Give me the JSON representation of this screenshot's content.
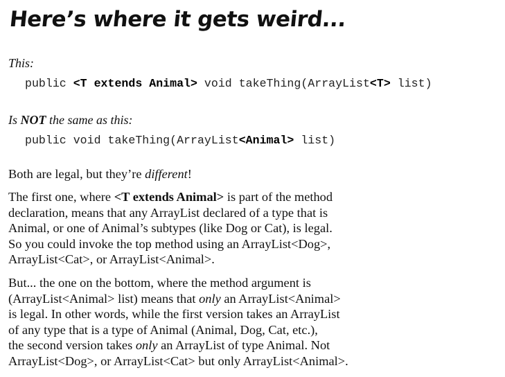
{
  "heading": "Here’s where it gets weird...",
  "label_this": "This:",
  "code_1": {
    "part_a": "public ",
    "part_b": "<T extends Animal>",
    "part_c": " void takeThing(ArrayList",
    "part_d": "<T>",
    "part_e": " list)"
  },
  "label_not_same": {
    "part_a": "Is ",
    "part_b": "NOT",
    "part_c": " the same as this:"
  },
  "code_2": {
    "part_a": "public void takeThing(ArrayList",
    "part_b": "<Animal>",
    "part_c": " list)"
  },
  "para_1": {
    "part_a": "Both are legal, but they’re ",
    "part_b": "different",
    "part_c": "!"
  },
  "para_2": {
    "line_1_a": "The first one, where ",
    "line_1_b": "<T extends Animal>",
    "line_1_c": " is part of the method",
    "line_2": "declaration, means that any ArrayList declared of a type that is",
    "line_3": "Animal, or one of Animal’s subtypes (like Dog or Cat), is legal.",
    "line_4": "So you could invoke the top method using an ArrayList<Dog>,",
    "line_5": "ArrayList<Cat>, or ArrayList<Animal>."
  },
  "para_3": {
    "line_1": "But... the one on the bottom, where the method argument is",
    "line_2_a": "(ArrayList<Animal> list) means that ",
    "line_2_b": "only",
    "line_2_c": " an ArrayList<Animal>",
    "line_3": "is legal. In other words, while the first version takes an ArrayList",
    "line_4": "of any type that is a type of Animal (Animal, Dog, Cat, etc.),",
    "line_5_a": "the second version takes ",
    "line_5_b": "only",
    "line_5_c": " an ArrayList of type Animal. Not",
    "line_6": "ArrayList<Dog>, or ArrayList<Cat> but only ArrayList<Animal>."
  }
}
